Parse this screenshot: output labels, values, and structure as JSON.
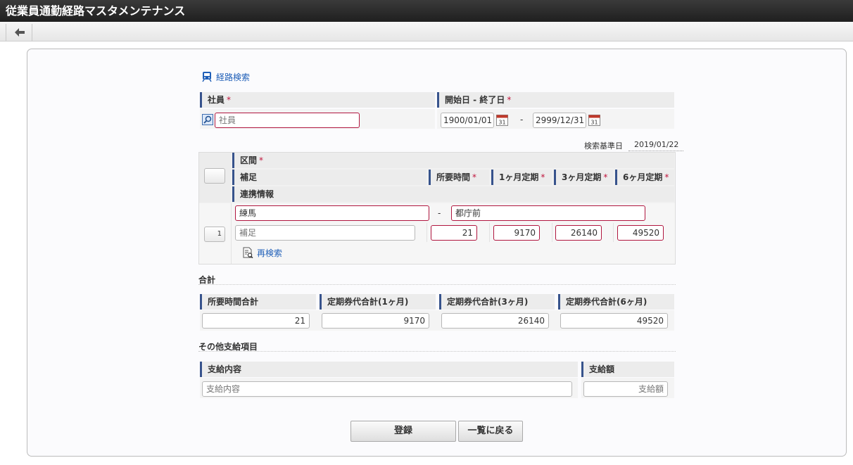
{
  "app": {
    "title": "従業員通勤経路マスタメンテナンス"
  },
  "search": {
    "link_label": "経路検索"
  },
  "employee": {
    "header": "社員",
    "required": "*",
    "placeholder": "社員"
  },
  "period": {
    "header": "開始日 - 終了日",
    "required": "*",
    "start": "1900/01/01",
    "separator": "-",
    "end": "2999/12/31"
  },
  "search_date": {
    "label": "検索基準日",
    "value": "2019/01/22"
  },
  "route_table": {
    "headers": {
      "section": "区間",
      "note": "補足",
      "time": "所要時間",
      "month1": "1ヶ月定期",
      "month3": "3ヶ月定期",
      "month6": "6ヶ月定期",
      "link_info": "連携情報"
    },
    "required": "*",
    "row": {
      "index": "1",
      "from": "練馬",
      "dash": "-",
      "to": "都庁前",
      "note_placeholder": "補足",
      "time": "21",
      "month1": "9170",
      "month3": "26140",
      "month6": "49520",
      "research_label": "再検索"
    }
  },
  "totals": {
    "section_title": "合計",
    "headers": {
      "time": "所要時間合計",
      "m1": "定期券代合計(1ヶ月)",
      "m3": "定期券代合計(3ヶ月)",
      "m6": "定期券代合計(6ヶ月)"
    },
    "values": {
      "time": "21",
      "m1": "9170",
      "m3": "26140",
      "m6": "49520"
    }
  },
  "other": {
    "section_title": "その他支給項目",
    "headers": {
      "content": "支給内容",
      "amount": "支給額"
    },
    "placeholders": {
      "content": "支給内容",
      "amount": "支給額"
    }
  },
  "actions": {
    "register": "登録",
    "back": "一覧に戻る"
  },
  "colors": {
    "titlebar": "#2b2b2b",
    "accent": "#37538c",
    "error_border": "#b0163f",
    "link": "#1f5fb8",
    "required": "#c0143c"
  }
}
